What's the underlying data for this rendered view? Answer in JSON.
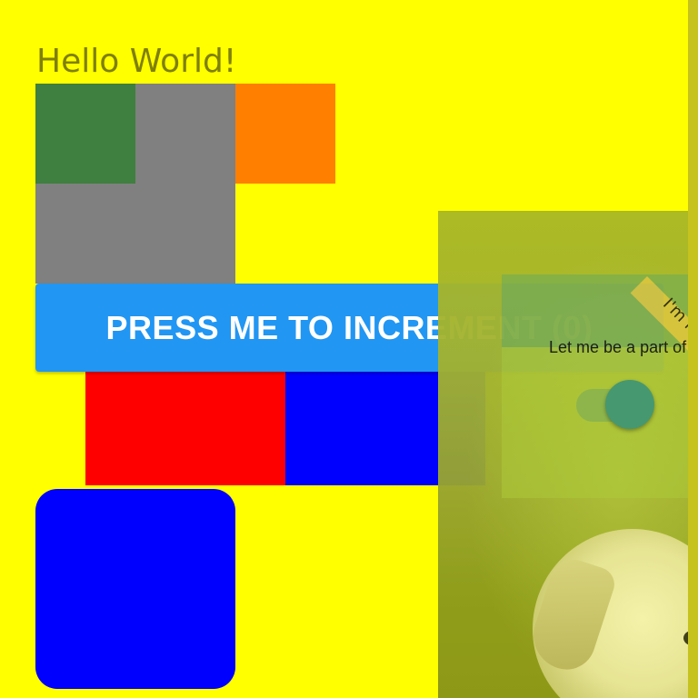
{
  "header": {
    "title": "Hello World!"
  },
  "button": {
    "label": "PRESS ME TO INCREMENT (0)",
    "count": 0
  },
  "overlay": {
    "diagonal_label": "I'm n",
    "caption": "Let me be a part of",
    "toggle_on": true
  },
  "colors": {
    "background": "#ffff00",
    "button": "#2196f3",
    "gray_block": "#808080",
    "green_block": "#3f7f3f",
    "orange_block": "#ff7f00",
    "red_block": "#ff0000",
    "blue_block": "#0000ff"
  }
}
